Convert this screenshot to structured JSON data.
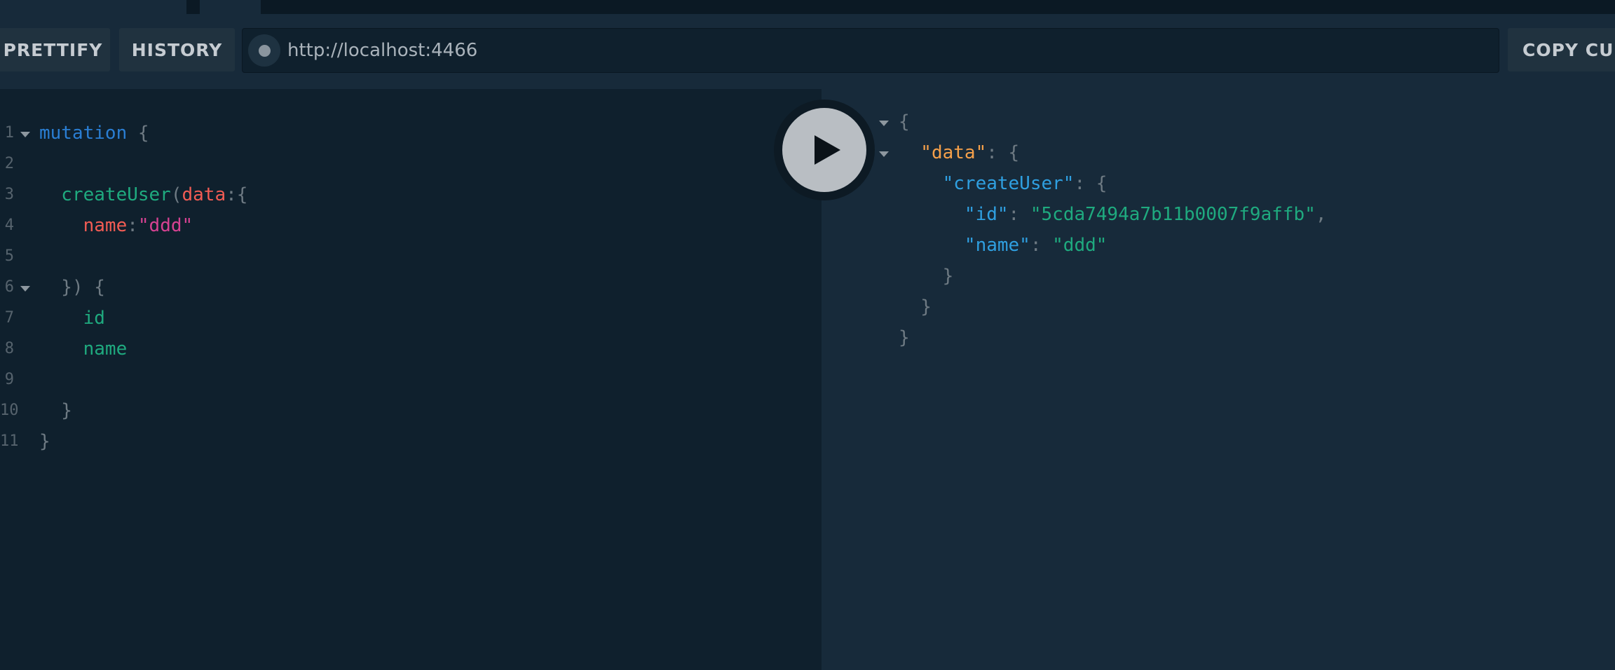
{
  "toolbar": {
    "prettify_label": "PRETTIFY",
    "history_label": "HISTORY",
    "copy_label": "COPY CUI",
    "endpoint_url": "http://localhost:4466"
  },
  "editor": {
    "lines": [
      {
        "num": "1",
        "tokens": [
          {
            "t": "mutation",
            "c": "kw"
          },
          {
            "t": " {",
            "c": "punc"
          }
        ]
      },
      {
        "num": "2",
        "tokens": []
      },
      {
        "num": "3",
        "tokens": [
          {
            "t": "  createUser",
            "c": "field"
          },
          {
            "t": "(",
            "c": "punc"
          },
          {
            "t": "data",
            "c": "arg"
          },
          {
            "t": ":{",
            "c": "punc"
          }
        ]
      },
      {
        "num": "4",
        "tokens": [
          {
            "t": "    name",
            "c": "arg"
          },
          {
            "t": ":",
            "c": "punc"
          },
          {
            "t": "\"ddd\"",
            "c": "str"
          }
        ]
      },
      {
        "num": "5",
        "tokens": []
      },
      {
        "num": "6",
        "tokens": [
          {
            "t": "  }) {",
            "c": "punc"
          }
        ]
      },
      {
        "num": "7",
        "tokens": [
          {
            "t": "    id",
            "c": "field"
          }
        ]
      },
      {
        "num": "8",
        "tokens": [
          {
            "t": "    name",
            "c": "field"
          }
        ]
      },
      {
        "num": "9",
        "tokens": []
      },
      {
        "num": "10",
        "tokens": [
          {
            "t": "  }",
            "c": "punc"
          }
        ]
      },
      {
        "num": "11",
        "tokens": [
          {
            "t": "}",
            "c": "punc"
          }
        ]
      }
    ]
  },
  "result": {
    "lines": [
      [
        {
          "t": "{",
          "c": "punc"
        }
      ],
      [
        {
          "t": "  \"data\"",
          "c": "jkey-orange"
        },
        {
          "t": ": {",
          "c": "punc"
        }
      ],
      [
        {
          "t": "    \"createUser\"",
          "c": "jkey-blue"
        },
        {
          "t": ": {",
          "c": "punc"
        }
      ],
      [
        {
          "t": "      \"id\"",
          "c": "jkey-blue"
        },
        {
          "t": ": ",
          "c": "punc"
        },
        {
          "t": "\"5cda7494a7b11b0007f9affb\"",
          "c": "jstr"
        },
        {
          "t": ",",
          "c": "punc"
        }
      ],
      [
        {
          "t": "      \"name\"",
          "c": "jkey-blue"
        },
        {
          "t": ": ",
          "c": "punc"
        },
        {
          "t": "\"ddd\"",
          "c": "jstr"
        }
      ],
      [
        {
          "t": "    }",
          "c": "punc"
        }
      ],
      [
        {
          "t": "  }",
          "c": "punc"
        }
      ],
      [
        {
          "t": "}",
          "c": "punc"
        }
      ]
    ]
  },
  "icons": {
    "run": "play-icon",
    "status": "status-dot-icon",
    "fold": "fold-arrow-icon"
  }
}
